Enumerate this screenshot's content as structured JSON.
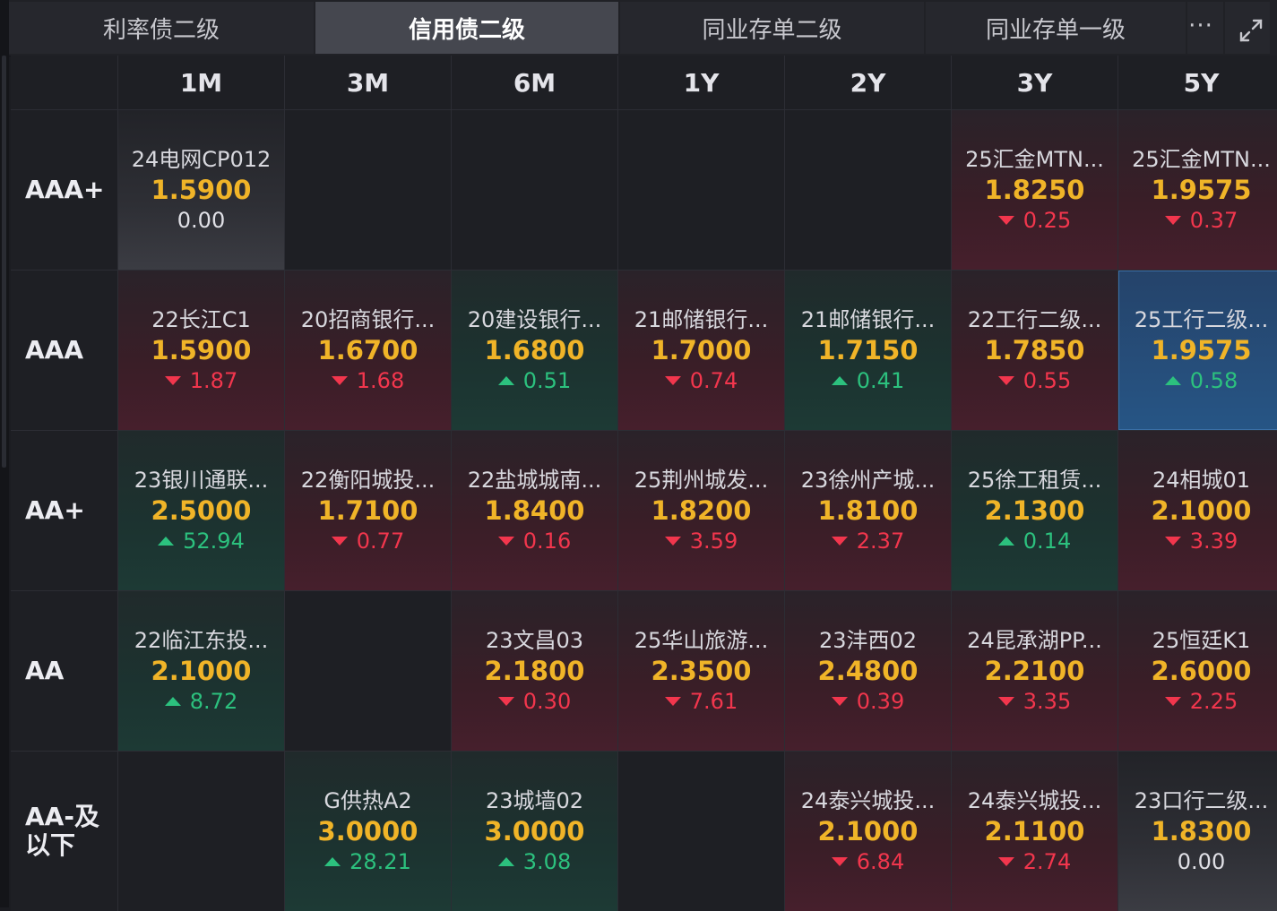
{
  "tabs": [
    {
      "label": "利率债二级",
      "active": false
    },
    {
      "label": "信用债二级",
      "active": true
    },
    {
      "label": "同业存单二级",
      "active": false
    },
    {
      "label": "同业存单一级",
      "active": false
    }
  ],
  "more_label": "···",
  "columns": [
    "1M",
    "3M",
    "6M",
    "1Y",
    "2Y",
    "3Y",
    "5Y"
  ],
  "rows": [
    {
      "label_lines": [
        "AAA+"
      ],
      "cells": [
        {
          "name": "24电网CP012",
          "yield": "1.5900",
          "change": "0.00",
          "dir": "flat"
        },
        null,
        null,
        null,
        null,
        {
          "name": "25汇金MTN...",
          "yield": "1.8250",
          "change": "0.25",
          "dir": "down"
        },
        {
          "name": "25汇金MTN...",
          "yield": "1.9575",
          "change": "0.37",
          "dir": "down"
        }
      ]
    },
    {
      "label_lines": [
        "AAA"
      ],
      "cells": [
        {
          "name": "22长江C1",
          "yield": "1.5900",
          "change": "1.87",
          "dir": "down"
        },
        {
          "name": "20招商银行...",
          "yield": "1.6700",
          "change": "1.68",
          "dir": "down"
        },
        {
          "name": "20建设银行...",
          "yield": "1.6800",
          "change": "0.51",
          "dir": "up"
        },
        {
          "name": "21邮储银行...",
          "yield": "1.7000",
          "change": "0.74",
          "dir": "down"
        },
        {
          "name": "21邮储银行...",
          "yield": "1.7150",
          "change": "0.41",
          "dir": "up"
        },
        {
          "name": "22工行二级...",
          "yield": "1.7850",
          "change": "0.55",
          "dir": "down"
        },
        {
          "name": "25工行二级...",
          "yield": "1.9575",
          "change": "0.58",
          "dir": "up",
          "selected": true
        }
      ]
    },
    {
      "label_lines": [
        "AA+"
      ],
      "cells": [
        {
          "name": "23银川通联...",
          "yield": "2.5000",
          "change": "52.94",
          "dir": "up"
        },
        {
          "name": "22衡阳城投...",
          "yield": "1.7100",
          "change": "0.77",
          "dir": "down"
        },
        {
          "name": "22盐城城南...",
          "yield": "1.8400",
          "change": "0.16",
          "dir": "down"
        },
        {
          "name": "25荆州城发...",
          "yield": "1.8200",
          "change": "3.59",
          "dir": "down"
        },
        {
          "name": "23徐州产城...",
          "yield": "1.8100",
          "change": "2.37",
          "dir": "down"
        },
        {
          "name": "25徐工租赁...",
          "yield": "2.1300",
          "change": "0.14",
          "dir": "up"
        },
        {
          "name": "24相城01",
          "yield": "2.1000",
          "change": "3.39",
          "dir": "down"
        }
      ]
    },
    {
      "label_lines": [
        "AA"
      ],
      "cells": [
        {
          "name": "22临江东投...",
          "yield": "2.1000",
          "change": "8.72",
          "dir": "up"
        },
        null,
        {
          "name": "23文昌03",
          "yield": "2.1800",
          "change": "0.30",
          "dir": "down"
        },
        {
          "name": "25华山旅游...",
          "yield": "2.3500",
          "change": "7.61",
          "dir": "down"
        },
        {
          "name": "23沣西02",
          "yield": "2.4800",
          "change": "0.39",
          "dir": "down"
        },
        {
          "name": "24昆承湖PP...",
          "yield": "2.2100",
          "change": "3.35",
          "dir": "down"
        },
        {
          "name": "25恒廷K1",
          "yield": "2.6000",
          "change": "2.25",
          "dir": "down"
        }
      ]
    },
    {
      "label_lines": [
        "AA-及",
        "以下"
      ],
      "cells": [
        null,
        {
          "name": "G供热A2",
          "yield": "3.0000",
          "change": "28.21",
          "dir": "up"
        },
        {
          "name": "23城墙02",
          "yield": "3.0000",
          "change": "3.08",
          "dir": "up"
        },
        null,
        {
          "name": "24泰兴城投...",
          "yield": "2.1000",
          "change": "6.84",
          "dir": "down"
        },
        {
          "name": "24泰兴城投...",
          "yield": "2.1100",
          "change": "2.74",
          "dir": "down"
        },
        {
          "name": "23口行二级...",
          "yield": "1.8300",
          "change": "0.00",
          "dir": "flat"
        }
      ]
    }
  ],
  "colors": {
    "yield": "#f0b428",
    "down": "#f2364d",
    "up": "#2cc17e",
    "selected": "#265585"
  }
}
